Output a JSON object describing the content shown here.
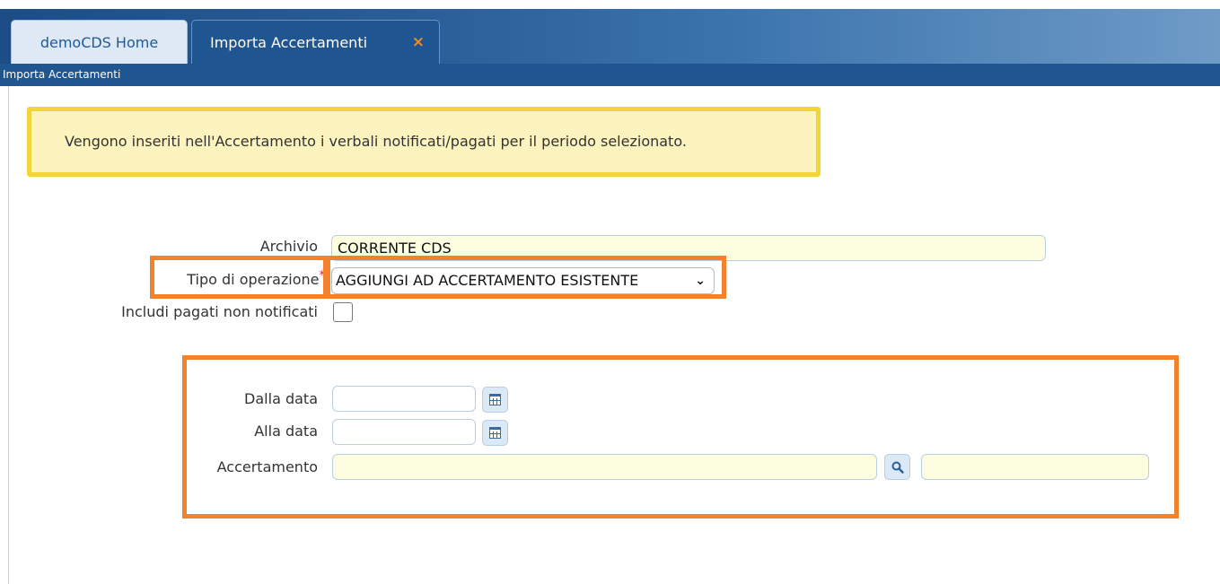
{
  "tabs": [
    {
      "label": "demoCDS Home"
    },
    {
      "label": "Importa Accertamenti",
      "close": "×"
    }
  ],
  "breadcrumb": "Importa Accertamenti",
  "info_note": "Vengono inseriti nell'Accertamento i verbali notificati/pagati per il periodo selezionato.",
  "form": {
    "archivio": {
      "label": "Archivio",
      "value": "CORRENTE CDS"
    },
    "tipo_operazione": {
      "label": "Tipo di operazione",
      "required_mark": "*",
      "selected": "AGGIUNGI AD ACCERTAMENTO ESISTENTE"
    },
    "includi_pagati": {
      "label": "Includi pagati non notificati",
      "checked": false
    },
    "dalla_data": {
      "label": "Dalla data",
      "value": ""
    },
    "alla_data": {
      "label": "Alla data",
      "value": ""
    },
    "accertamento": {
      "label": "Accertamento",
      "value": "",
      "description": ""
    }
  },
  "icons": {
    "calendar": "calendar-icon",
    "search": "search-icon"
  },
  "colors": {
    "header_blue": "#1f5590",
    "highlight_orange": "#f3822f",
    "note_yellow": "#f5d33a",
    "required_red": "#d9261c"
  }
}
